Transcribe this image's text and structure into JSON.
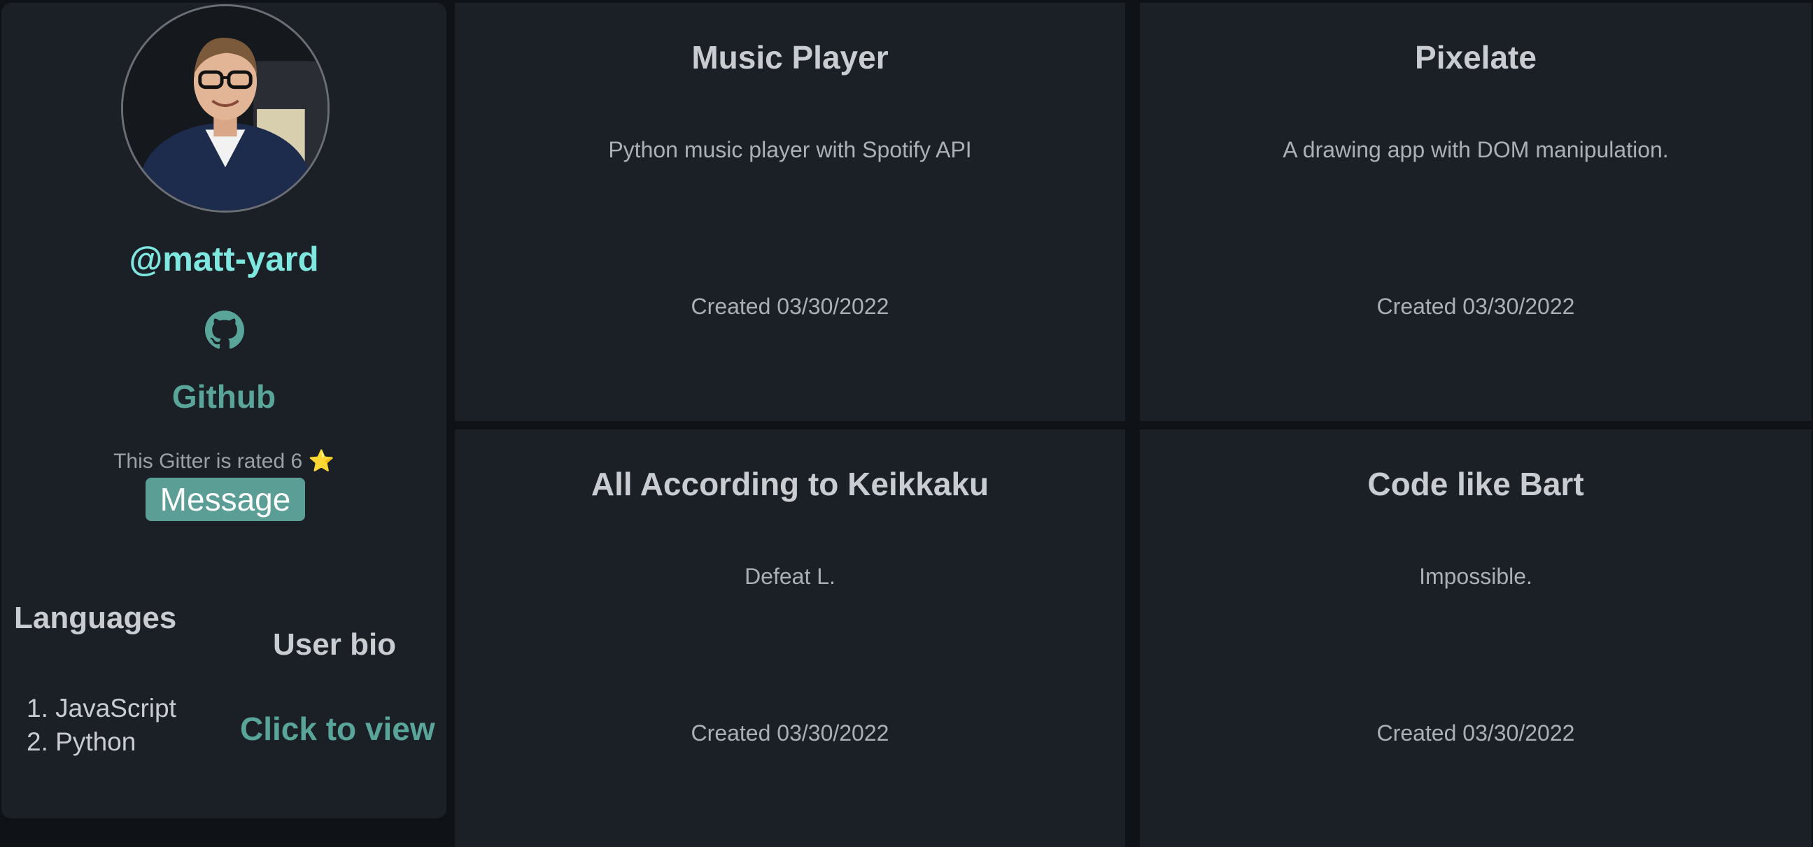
{
  "profile": {
    "handle": "@matt-yard",
    "github_icon": "github-icon",
    "github_label": "Github",
    "rating_text": "This Gitter is rated 6",
    "rating_icon": "⭐",
    "message_button": "Message",
    "languages_title": "Languages",
    "languages": [
      "1. JavaScript",
      "2. Python"
    ],
    "bio_title": "User bio",
    "bio_link": "Click to view"
  },
  "projects": [
    {
      "title": "Music Player",
      "description": "Python music player with Spotify API",
      "created": "Created 03/30/2022"
    },
    {
      "title": "Pixelate",
      "description": "A drawing app with DOM manipulation.",
      "created": "Created 03/30/2022"
    },
    {
      "title": "All According to Keikkaku",
      "description": "Defeat L.",
      "created": "Created 03/30/2022"
    },
    {
      "title": "Code like Bart",
      "description": "Impossible.",
      "created": "Created 03/30/2022"
    }
  ],
  "colors": {
    "background": "#0f1216",
    "card": "#1b2027",
    "accent": "#5aa59a",
    "handle": "#7fe7e0"
  }
}
